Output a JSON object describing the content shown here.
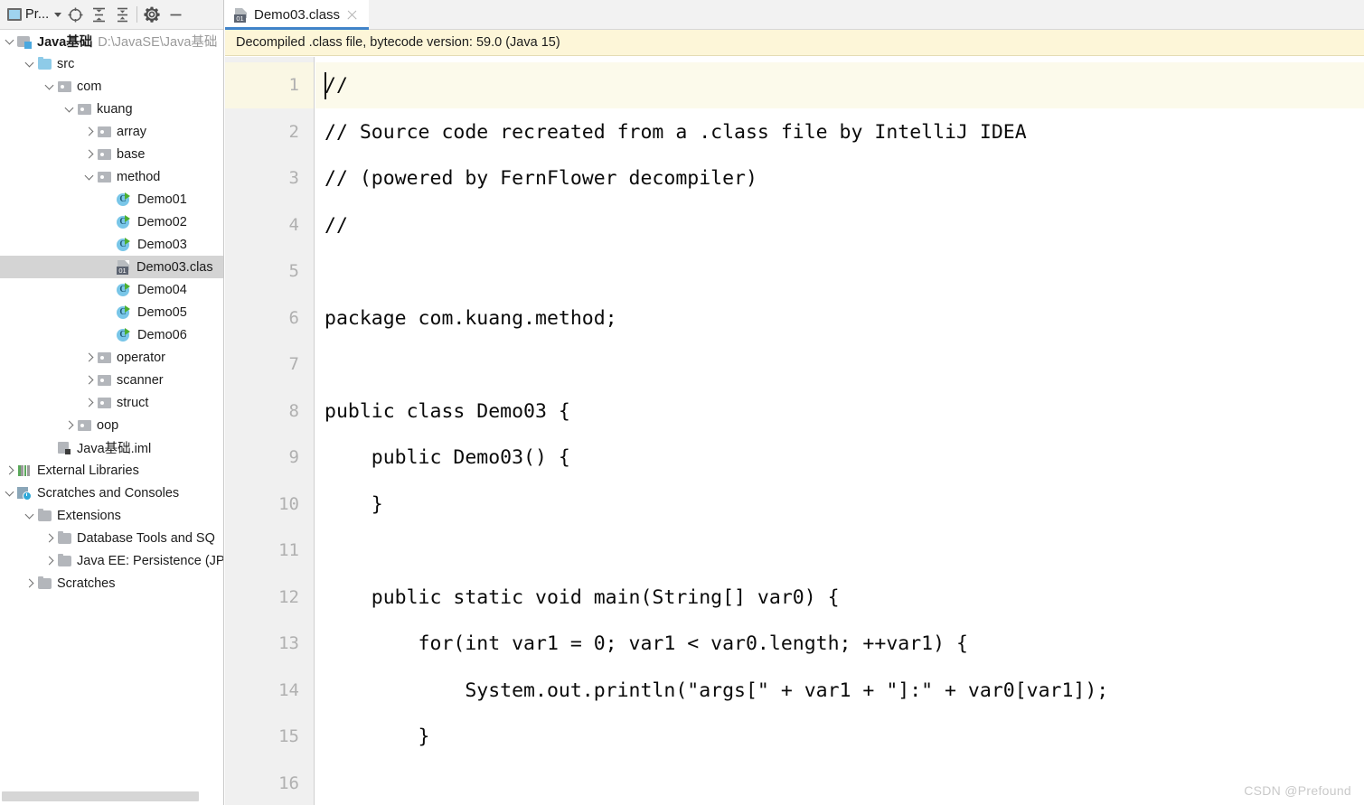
{
  "project_panel": {
    "toolbar": {
      "title": "Pr...",
      "window_icon": "project-window-icon",
      "dropdown_icon": "chevron-down-icon",
      "buttons": [
        {
          "name": "locate-in-tree-button",
          "icon": "crosshair-icon",
          "tooltip": "Select Opened File"
        },
        {
          "name": "expand-all-button",
          "icon": "expand-all-icon",
          "tooltip": "Expand All"
        },
        {
          "name": "collapse-all-button",
          "icon": "collapse-all-icon",
          "tooltip": "Collapse All"
        },
        {
          "name": "settings-button",
          "icon": "gear-icon",
          "tooltip": "Settings"
        },
        {
          "name": "hide-button",
          "icon": "minus-icon",
          "tooltip": "Hide"
        }
      ]
    },
    "tree": [
      {
        "id": "root",
        "label": "Java基础",
        "path": "D:\\JavaSE\\Java基础",
        "icon": "module-icon",
        "arrow": "down",
        "indent": 0,
        "bold": true,
        "selected": false
      },
      {
        "id": "src",
        "label": "src",
        "path": "",
        "icon": "src-folder-icon",
        "arrow": "down",
        "indent": 1,
        "bold": false,
        "selected": false
      },
      {
        "id": "com",
        "label": "com",
        "path": "",
        "icon": "package-icon",
        "arrow": "down",
        "indent": 2,
        "bold": false,
        "selected": false
      },
      {
        "id": "kuang",
        "label": "kuang",
        "path": "",
        "icon": "package-icon",
        "arrow": "down",
        "indent": 3,
        "bold": false,
        "selected": false
      },
      {
        "id": "array",
        "label": "array",
        "path": "",
        "icon": "package-icon",
        "arrow": "right",
        "indent": 4,
        "bold": false,
        "selected": false
      },
      {
        "id": "base",
        "label": "base",
        "path": "",
        "icon": "package-icon",
        "arrow": "right",
        "indent": 4,
        "bold": false,
        "selected": false
      },
      {
        "id": "method",
        "label": "method",
        "path": "",
        "icon": "package-icon",
        "arrow": "down",
        "indent": 4,
        "bold": false,
        "selected": false
      },
      {
        "id": "demo01",
        "label": "Demo01",
        "path": "",
        "icon": "java-class-icon",
        "arrow": "none",
        "indent": 5,
        "bold": false,
        "selected": false
      },
      {
        "id": "demo02",
        "label": "Demo02",
        "path": "",
        "icon": "java-class-icon",
        "arrow": "none",
        "indent": 5,
        "bold": false,
        "selected": false
      },
      {
        "id": "demo03",
        "label": "Demo03",
        "path": "",
        "icon": "java-class-icon",
        "arrow": "none",
        "indent": 5,
        "bold": false,
        "selected": false
      },
      {
        "id": "demo03class",
        "label": "Demo03.clas",
        "path": "",
        "icon": "class-file-icon",
        "arrow": "none",
        "indent": 5,
        "bold": false,
        "selected": true
      },
      {
        "id": "demo04",
        "label": "Demo04",
        "path": "",
        "icon": "java-class-icon",
        "arrow": "none",
        "indent": 5,
        "bold": false,
        "selected": false
      },
      {
        "id": "demo05",
        "label": "Demo05",
        "path": "",
        "icon": "java-class-icon",
        "arrow": "none",
        "indent": 5,
        "bold": false,
        "selected": false
      },
      {
        "id": "demo06",
        "label": "Demo06",
        "path": "",
        "icon": "java-class-icon",
        "arrow": "none",
        "indent": 5,
        "bold": false,
        "selected": false
      },
      {
        "id": "operator",
        "label": "operator",
        "path": "",
        "icon": "package-icon",
        "arrow": "right",
        "indent": 4,
        "bold": false,
        "selected": false
      },
      {
        "id": "scanner",
        "label": "scanner",
        "path": "",
        "icon": "package-icon",
        "arrow": "right",
        "indent": 4,
        "bold": false,
        "selected": false
      },
      {
        "id": "struct",
        "label": "struct",
        "path": "",
        "icon": "package-icon",
        "arrow": "right",
        "indent": 4,
        "bold": false,
        "selected": false
      },
      {
        "id": "oop",
        "label": "oop",
        "path": "",
        "icon": "package-icon",
        "arrow": "right",
        "indent": 3,
        "bold": false,
        "selected": false
      },
      {
        "id": "iml",
        "label": "Java基础.iml",
        "path": "",
        "icon": "iml-file-icon",
        "arrow": "none",
        "indent": 2,
        "bold": false,
        "selected": false
      },
      {
        "id": "extlibs",
        "label": "External Libraries",
        "path": "",
        "icon": "libraries-icon",
        "arrow": "right",
        "indent": 0,
        "bold": false,
        "selected": false
      },
      {
        "id": "scratches",
        "label": "Scratches and Consoles",
        "path": "",
        "icon": "scratches-icon",
        "arrow": "down",
        "indent": 0,
        "bold": false,
        "selected": false
      },
      {
        "id": "extensions",
        "label": "Extensions",
        "path": "",
        "icon": "folder-icon",
        "arrow": "down",
        "indent": 1,
        "bold": false,
        "selected": false
      },
      {
        "id": "dbtools",
        "label": "Database Tools and SQ",
        "path": "",
        "icon": "folder-icon",
        "arrow": "right",
        "indent": 2,
        "bold": false,
        "selected": false
      },
      {
        "id": "javaee",
        "label": "Java EE: Persistence (JP",
        "path": "",
        "icon": "folder-icon",
        "arrow": "right",
        "indent": 2,
        "bold": false,
        "selected": false
      },
      {
        "id": "scratchdir",
        "label": "Scratches",
        "path": "",
        "icon": "folder-icon",
        "arrow": "right",
        "indent": 1,
        "bold": false,
        "selected": false
      }
    ]
  },
  "editor": {
    "tab": {
      "label": "Demo03.class",
      "icon": "class-file-icon",
      "close_icon": "close-icon",
      "active": true,
      "accent_color": "#4083c9"
    },
    "notification": {
      "text": "Decompiled .class file, bytecode version: 59.0 (Java 15)",
      "background_color": "#fdf6d8"
    },
    "caret_line": 1,
    "lines": [
      {
        "n": "1",
        "text": "//"
      },
      {
        "n": "2",
        "text": "// Source code recreated from a .class file by IntelliJ IDEA"
      },
      {
        "n": "3",
        "text": "// (powered by FernFlower decompiler)"
      },
      {
        "n": "4",
        "text": "//"
      },
      {
        "n": "5",
        "text": ""
      },
      {
        "n": "6",
        "text": "package com.kuang.method;"
      },
      {
        "n": "7",
        "text": ""
      },
      {
        "n": "8",
        "text": "public class Demo03 {"
      },
      {
        "n": "9",
        "text": "    public Demo03() {"
      },
      {
        "n": "10",
        "text": "    }"
      },
      {
        "n": "11",
        "text": ""
      },
      {
        "n": "12",
        "text": "    public static void main(String[] var0) {"
      },
      {
        "n": "13",
        "text": "        for(int var1 = 0; var1 < var0.length; ++var1) {"
      },
      {
        "n": "14",
        "text": "            System.out.println(\"args[\" + var1 + \"]:\" + var0[var1]);"
      },
      {
        "n": "15",
        "text": "        }"
      },
      {
        "n": "16",
        "text": ""
      }
    ]
  },
  "watermark": {
    "text": "CSDN @Prefound"
  }
}
